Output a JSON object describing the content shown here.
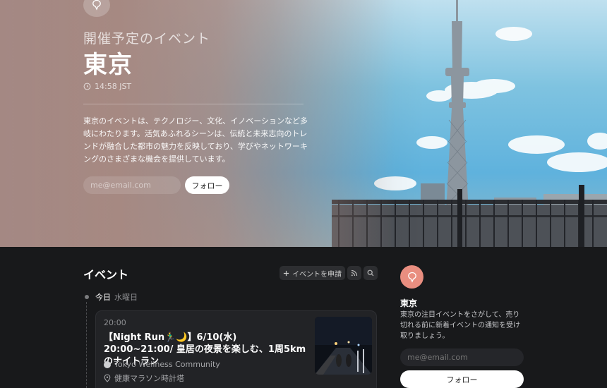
{
  "hero": {
    "subtitle": "開催予定のイベント",
    "city": "東京",
    "time": "14:58 JST",
    "description": "東京のイベントは、テクノロジー、文化、イノベーションなど多岐にわたります。活気あふれるシーンは、伝統と未来志向のトレンドが融合した都市の魅力を反映しており、学びやネットワーキングのさまざまな機会を提供しています。",
    "email_placeholder": "me@email.com",
    "follow_label": "フォロー"
  },
  "events": {
    "heading": "イベント",
    "submit_label": "イベントを申請",
    "day": {
      "today": "今日",
      "weekday": "水曜日"
    },
    "card": {
      "time": "20:00",
      "title": "【Night Run🏃‍♂️🌙】6/10(水) 20:00~21:00/ 皇居の夜景を楽しむ、1周5kmのナイトラン",
      "host": "Tokyo Wellness Community",
      "location": "健康マラソン時計塔"
    }
  },
  "sidebar": {
    "city": "東京",
    "description": "東京の注目イベントをさがして、売り切れる前に新着イベントの通知を受け取りましょう。",
    "email_placeholder": "me@email.com",
    "follow_label": "フォロー"
  },
  "icons": {
    "city_icon": "balloon-pin-icon",
    "clock": "clock-icon",
    "plus": "plus-icon",
    "rss": "rss-icon",
    "search": "search-icon",
    "location": "map-pin-icon"
  },
  "colors": {
    "accent": "#e98e80",
    "page_bg": "#18191b",
    "card_bg": "#222326"
  }
}
